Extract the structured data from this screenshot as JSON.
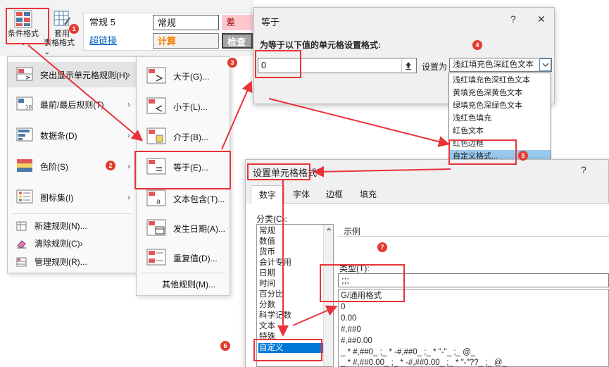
{
  "ribbon": {
    "conditional_format": {
      "line1": "条件格式",
      "line2": "⌄"
    },
    "table_format": {
      "line1": "套用",
      "line2": "表格格式 ⌄"
    },
    "styles": {
      "normal5": "常规 5",
      "normal": "常规",
      "bad": "差",
      "hyperlink": "超链接",
      "calc": "计算",
      "check": "检查"
    }
  },
  "menu_main": {
    "items": [
      {
        "label": "突出显示单元格规则(H)"
      },
      {
        "label": "最前/最后规则(T)"
      },
      {
        "label": "数据条(D)"
      },
      {
        "label": "色阶(S)"
      },
      {
        "label": "图标集(I)"
      }
    ],
    "small_items": [
      {
        "label": "新建规则(N)..."
      },
      {
        "label": "清除规则(C)"
      },
      {
        "label": "管理规则(R)..."
      }
    ],
    "chevron": "›"
  },
  "menu_sub": {
    "items": [
      {
        "label": "大于(G)..."
      },
      {
        "label": "小于(L)..."
      },
      {
        "label": "介于(B)..."
      },
      {
        "label": "等于(E)..."
      },
      {
        "label": "文本包含(T)..."
      },
      {
        "label": "发生日期(A)..."
      },
      {
        "label": "重复值(D)..."
      }
    ],
    "more": "其他规则(M)..."
  },
  "dialog_equal": {
    "title": "等于",
    "help": "?",
    "close": "✕",
    "instruction": "为等于以下值的单元格设置格式:",
    "value": "0",
    "set_as": "设置为",
    "selected": "浅红填充色深红色文本",
    "options": [
      "浅红填充色深红色文本",
      "黄填充色深黄色文本",
      "绿填充色深绿色文本",
      "浅红色填充",
      "红色文本",
      "红色边框",
      "自定义格式..."
    ]
  },
  "dialog_format": {
    "title": "设置单元格格式",
    "help": "?",
    "tabs": [
      "数字",
      "字体",
      "边框",
      "填充"
    ],
    "category_label": "分类(C):",
    "categories": [
      "常规",
      "数值",
      "货币",
      "会计专用",
      "日期",
      "时间",
      "百分比",
      "分数",
      "科学记数",
      "文本",
      "特殊",
      "自定义"
    ],
    "sample_label": "示例",
    "type_label": "类型(T):",
    "type_value": ";;;",
    "formats": [
      "G/通用格式",
      "0",
      "0.00",
      "#,##0",
      "#,##0.00",
      "_ * #,##0_ ;_ * -#,##0_ ;_ * \"-\"_ ;_ @_",
      "_ * #,##0.00_ ;_ * -#,##0.00_ ;_ * \"-\"??_ ;_ @_"
    ]
  },
  "badges": [
    "1",
    "2",
    "3",
    "4",
    "5",
    "6",
    "7"
  ],
  "colors": {
    "annotation_red": "#e8333a",
    "badge_red": "#e23b30",
    "selection_blue": "#99c9ef",
    "list_highlight": "#0078d7",
    "style_bad_bg": "#ffc7ce",
    "style_bad_text": "#9c0006",
    "style_calc_text": "#fa7d00",
    "style_check_bg": "#a5a5a5",
    "hyperlink": "#0563c1"
  }
}
